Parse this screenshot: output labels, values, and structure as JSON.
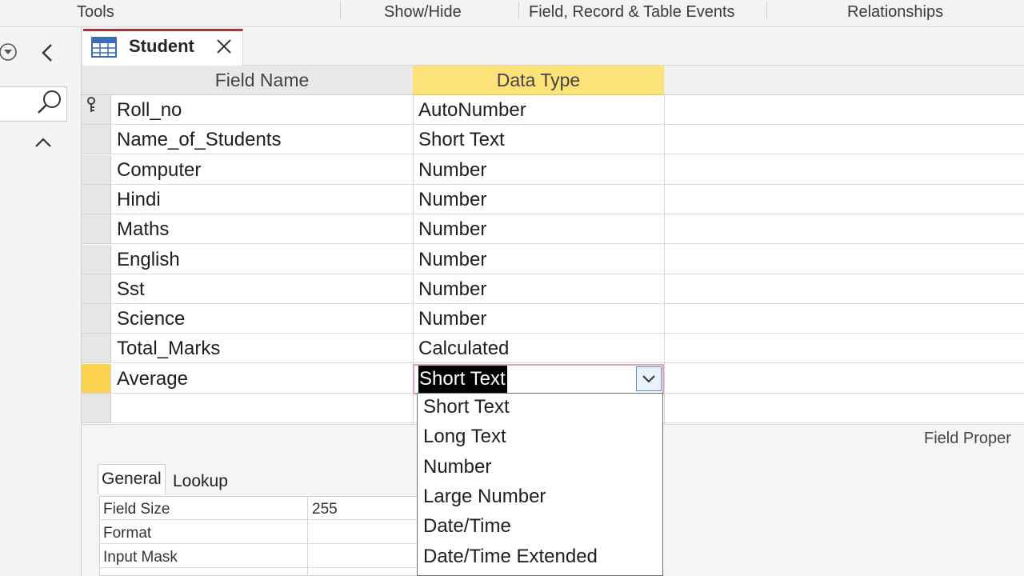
{
  "ribbon": {
    "groups": [
      "Tools",
      "Show/Hide",
      "Field, Record & Table Events",
      "Relationships"
    ]
  },
  "navigation": {
    "menu_icon": "chevron-circle-down-icon",
    "collapse_icon": "chevron-left-icon",
    "search_icon": "search-icon",
    "up_icon": "chevron-up-icon"
  },
  "document_tab": {
    "label": "Student",
    "icon": "table-icon",
    "close_icon": "close-icon"
  },
  "grid": {
    "headers": {
      "field_name": "Field Name",
      "data_type": "Data Type"
    },
    "rows": [
      {
        "field": "Roll_no",
        "type": "AutoNumber",
        "primary_key": true
      },
      {
        "field": "Name_of_Students",
        "type": "Short Text"
      },
      {
        "field": "Computer",
        "type": "Number"
      },
      {
        "field": "Hindi",
        "type": "Number"
      },
      {
        "field": "Maths",
        "type": "Number"
      },
      {
        "field": "English",
        "type": "Number"
      },
      {
        "field": "Sst",
        "type": "Number"
      },
      {
        "field": "Science",
        "type": "Number"
      },
      {
        "field": "Total_Marks",
        "type": "Calculated"
      },
      {
        "field": "Average",
        "type": "Short Text",
        "current": true
      }
    ]
  },
  "data_type_dropdown": {
    "selected": "Short Text",
    "options": [
      "Short Text",
      "Long Text",
      "Number",
      "Large Number",
      "Date/Time",
      "Date/Time Extended"
    ]
  },
  "field_properties": {
    "label": "Field Proper",
    "tabs": [
      "General",
      "Lookup"
    ],
    "active_tab": "General",
    "rows": [
      {
        "name": "Field Size",
        "value": "255"
      },
      {
        "name": "Format",
        "value": ""
      },
      {
        "name": "Input Mask",
        "value": ""
      }
    ]
  },
  "colors": {
    "selected_header": "#fde27a",
    "current_row_selector": "#fbd24d",
    "tab_accent": "#a4373a",
    "highlight_text_bg": "#000000"
  }
}
